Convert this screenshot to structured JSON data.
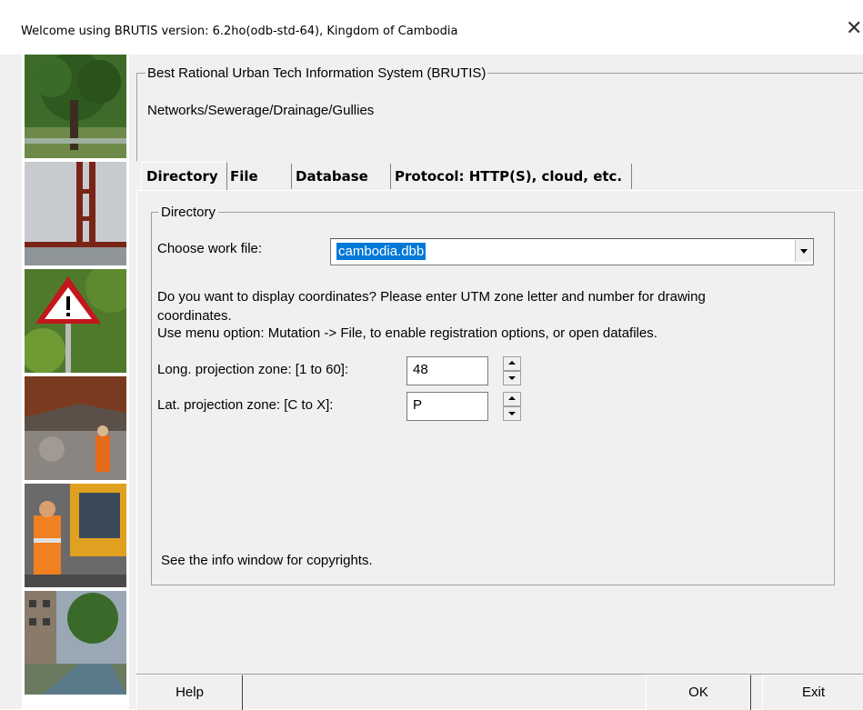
{
  "window": {
    "title": "Welcome using BRUTIS version: 6.2ho(odb-std-64), Kingdom of Cambodia"
  },
  "header": {
    "group_title": "Best Rational Urban Tech Information System (BRUTIS)",
    "subtitle": "Networks/Sewerage/Drainage/Gullies"
  },
  "tabs": [
    {
      "label": "Directory"
    },
    {
      "label": "File"
    },
    {
      "label": "Database"
    },
    {
      "label": "Protocol: HTTP(S), cloud, etc."
    }
  ],
  "directory": {
    "group_title": "Directory",
    "work_file_label": "Choose work file:",
    "work_file_value": "cambodia.dbb",
    "info_line1": "Do you want to display coordinates?  Please enter UTM zone letter and number for drawing",
    "info_line2": "coordinates.",
    "info_line3": "Use menu option: Mutation -> File, to enable registration options, or open datafiles.",
    "long_label": "Long. projection zone: [1 to 60]:",
    "long_value": "48",
    "lat_label": "Lat. projection zone: [C to X]:",
    "lat_value": "P",
    "copyright_note": "See the info window for copyrights."
  },
  "buttons": {
    "help": "Help",
    "ok": "OK",
    "exit": "Exit"
  },
  "icons": {
    "close": "close-icon"
  }
}
